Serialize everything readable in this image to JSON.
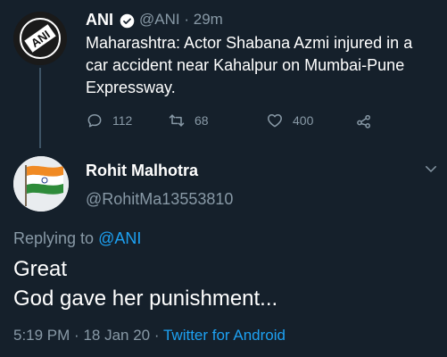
{
  "parent_tweet": {
    "name": "ANI",
    "handle": "@ANI",
    "separator": "·",
    "time": "29m",
    "text": "Maharashtra: Actor Shabana Azmi injured in a car accident near Kahalpur on Mumbai-Pune Expressway.",
    "avatar_text": "ANI",
    "reply_count": "112",
    "retweet_count": "68",
    "like_count": "400"
  },
  "reply_tweet": {
    "name": "Rohit Malhotra",
    "handle": "@RohitMa13553810",
    "replying_prefix": "Replying to",
    "replying_to": "@ANI",
    "text_line1": "Great",
    "text_line2": "God gave her punishment...",
    "time": "5:19 PM",
    "date": "18 Jan 20",
    "client": "Twitter for Android"
  },
  "colors": {
    "background": "#15202b",
    "secondary_text": "#8899a6",
    "accent": "#1da1f2"
  },
  "icons": [
    "verified-icon",
    "reply-icon",
    "retweet-icon",
    "like-icon",
    "share-icon",
    "more-icon"
  ]
}
